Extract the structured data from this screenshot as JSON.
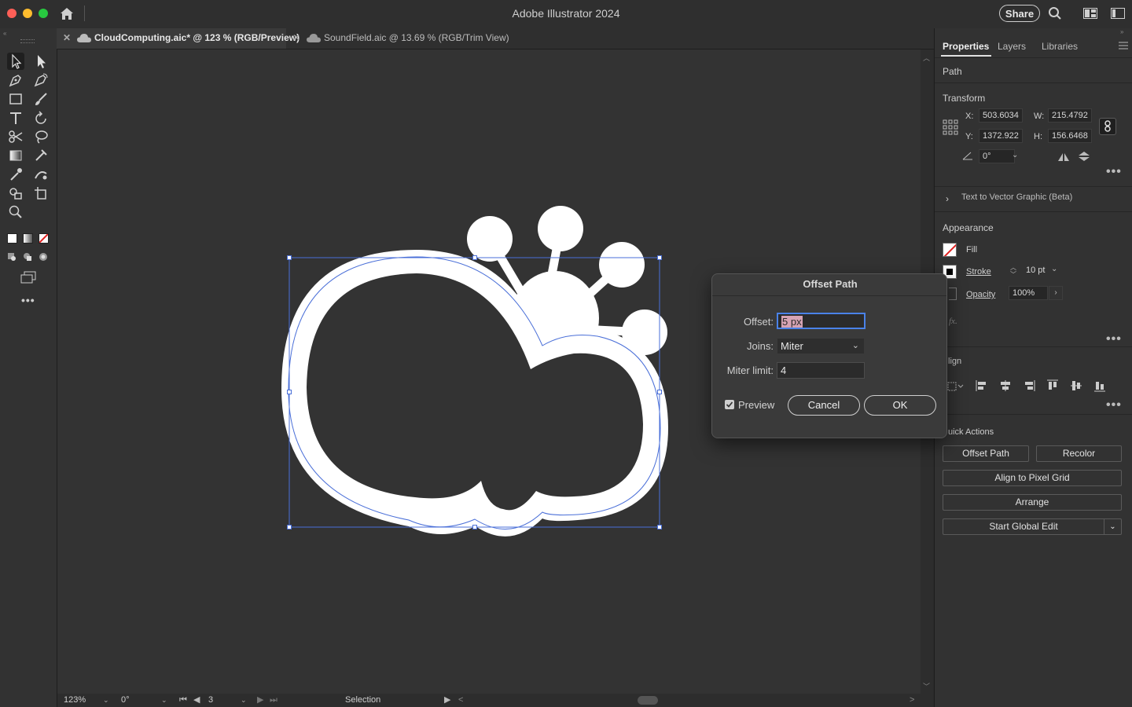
{
  "app": {
    "title": "Adobe Illustrator 2024",
    "share_label": "Share"
  },
  "tabs": [
    {
      "label": "CloudComputing.aic* @ 123 % (RGB/Preview)",
      "active": true
    },
    {
      "label": "SoundField.aic @ 13.69 % (RGB/Trim View)",
      "active": false
    }
  ],
  "panel": {
    "tabs": [
      "Properties",
      "Layers",
      "Libraries"
    ],
    "selection_type": "Path",
    "transform": {
      "title": "Transform",
      "x_label": "X:",
      "x": "503.6034",
      "y_label": "Y:",
      "y": "1372.922",
      "w_label": "W:",
      "w": "215.4792",
      "h_label": "H:",
      "h": "156.6468",
      "angle": "0°"
    },
    "text_to_vector": "Text to Vector Graphic (Beta)",
    "appearance": {
      "title": "Appearance",
      "fill_label": "Fill",
      "stroke_label": "Stroke",
      "stroke_value": "10 pt",
      "opacity_label": "Opacity",
      "opacity_value": "100%",
      "fx_label": "fx."
    },
    "align_title": "lign",
    "quick_actions": {
      "title": "uick Actions",
      "offset_path": "Offset Path",
      "recolor": "Recolor",
      "align_pixel_grid": "Align to Pixel Grid",
      "arrange": "Arrange",
      "start_global_edit": "Start Global Edit"
    }
  },
  "dialog": {
    "title": "Offset Path",
    "offset_label": "Offset:",
    "offset_value": "5 px",
    "joins_label": "Joins:",
    "joins_value": "Miter",
    "miter_label": "Miter limit:",
    "miter_value": "4",
    "preview_label": "Preview",
    "preview_checked": true,
    "cancel_label": "Cancel",
    "ok_label": "OK"
  },
  "status": {
    "zoom": "123%",
    "rotation": "0°",
    "artboard": "3",
    "tool": "Selection"
  },
  "colors": {
    "accent": "#4a6fd8",
    "canvas": "#333333",
    "panel": "#323232"
  }
}
